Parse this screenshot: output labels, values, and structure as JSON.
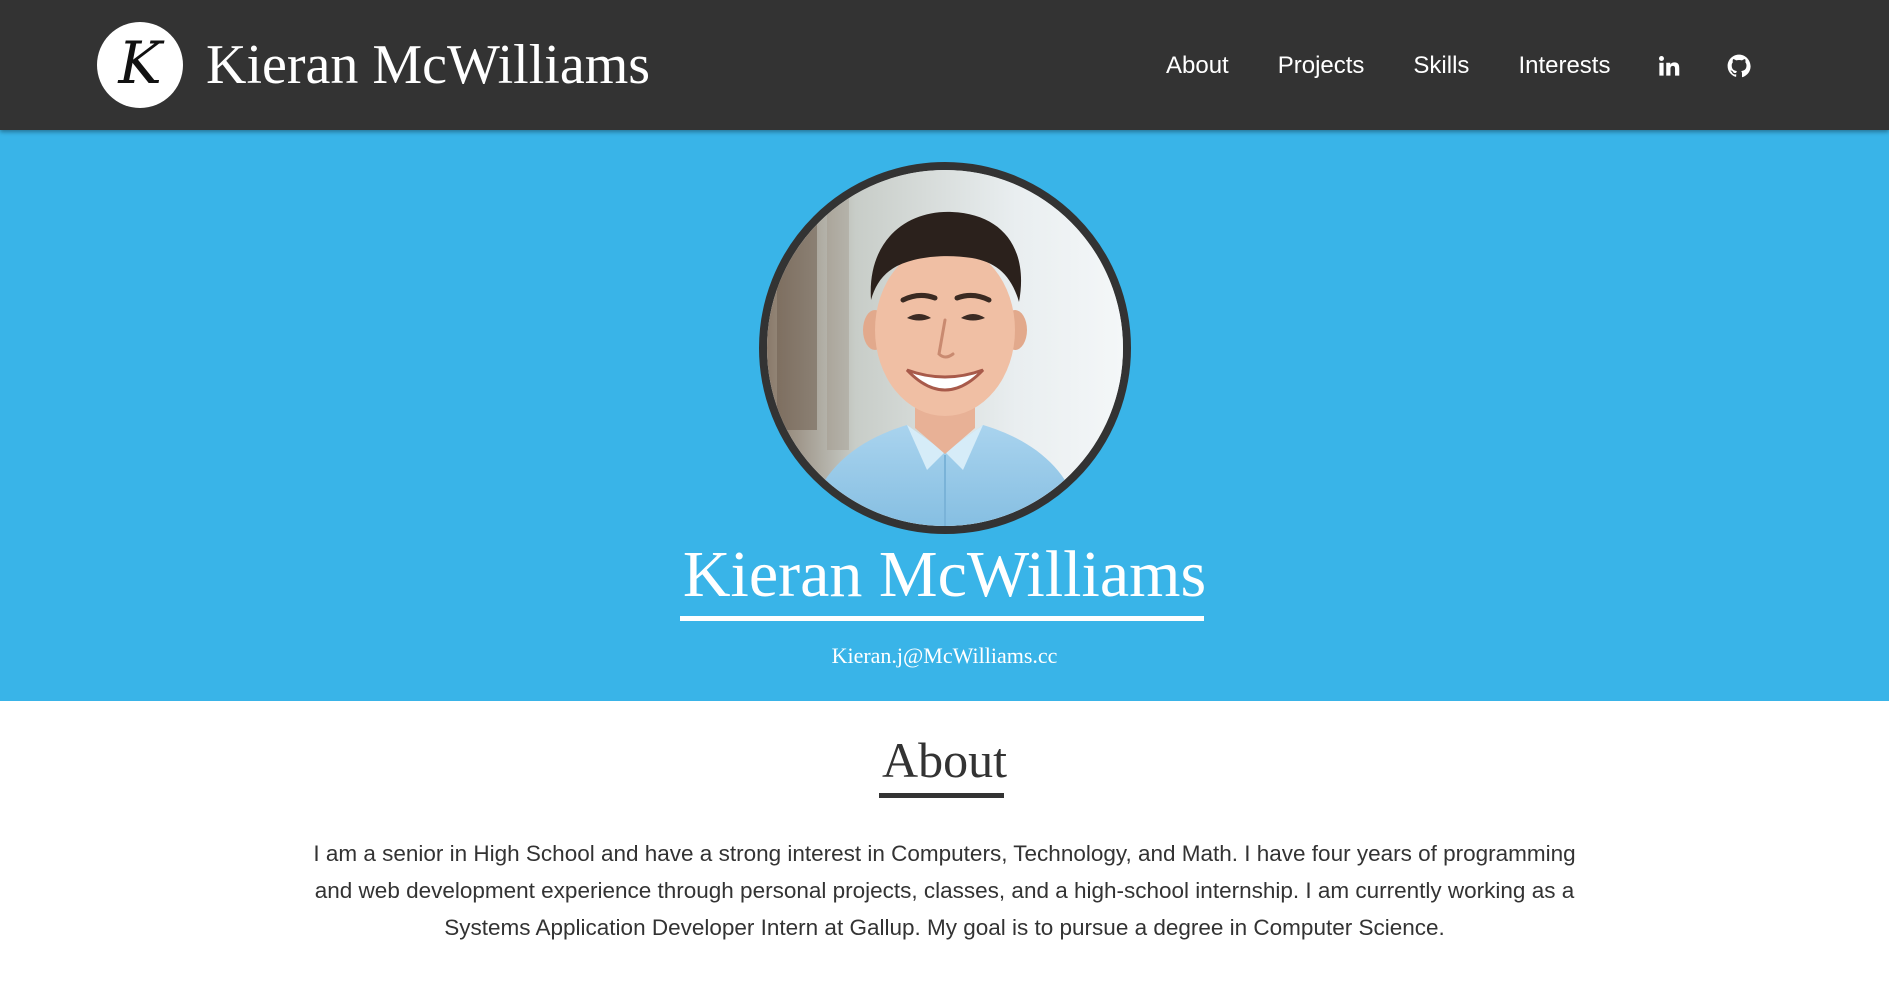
{
  "navbar": {
    "logo_letter": "K",
    "brand_name": "Kieran McWilliams",
    "links": [
      {
        "label": "About"
      },
      {
        "label": "Projects"
      },
      {
        "label": "Skills"
      },
      {
        "label": "Interests"
      }
    ],
    "icons": [
      "linkedin-icon",
      "github-icon"
    ],
    "background_color": "#333333"
  },
  "hero": {
    "name": "Kieran McWilliams",
    "email": "Kieran.j@McWilliams.cc",
    "background_color": "#39b4e8",
    "photo": "profile-photo"
  },
  "about": {
    "title": "About",
    "text": "I am a senior in High School and have a strong interest in Computers, Technology, and Math. I have four years of programming and web development experience through personal projects, classes, and a high-school internship. I am currently working as a Systems Application Developer Intern at Gallup. My goal is to pursue a degree in Computer Science."
  }
}
